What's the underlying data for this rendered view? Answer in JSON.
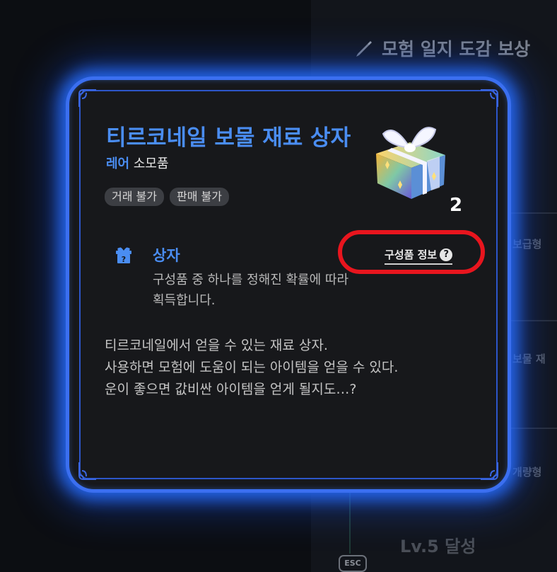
{
  "background": {
    "header": "모험 일지 도감 보상",
    "right_labels": [
      "일 보급형",
      "일 보물 재",
      "일 개량형"
    ],
    "level_text": "Lv.5 달성",
    "esc_label": "ESC"
  },
  "tooltip": {
    "title": "티르코네일 보물 재료 상자",
    "rarity": "레어",
    "item_type": "소모품",
    "tags": [
      "거래 불가",
      "판매 불가"
    ],
    "count": "2",
    "section": {
      "title": "상자",
      "desc_line1": "구성품 중 하나를 정해진 확률에 따라",
      "desc_line2": "획득합니다."
    },
    "component_info_label": "구성품 정보",
    "component_info_icon": "question-icon",
    "flavor_lines": [
      "티르코네일에서 얻을 수 있는 재료 상자.",
      "사용하면 모험에 도움이 되는 아이템을 얻을 수 있다.",
      "운이 좋으면 값비싼 아이템을 얻게 될지도…?"
    ]
  },
  "colors": {
    "accent_blue": "#4a8df2",
    "frame_glow": "#3b6ff0",
    "highlight_red": "#e8151e"
  }
}
